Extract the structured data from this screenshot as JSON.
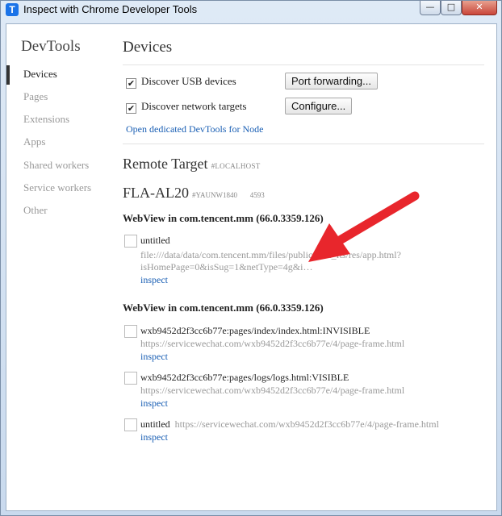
{
  "window": {
    "title": "Inspect with Chrome Developer Tools",
    "icon_letter": "T",
    "minimize": "—",
    "maximize": "□",
    "close": "✕"
  },
  "sidebar": {
    "title": "DevTools",
    "items": [
      {
        "label": "Devices",
        "active": true
      },
      {
        "label": "Pages"
      },
      {
        "label": "Extensions"
      },
      {
        "label": "Apps"
      },
      {
        "label": "Shared workers"
      },
      {
        "label": "Service workers"
      },
      {
        "label": "Other"
      }
    ]
  },
  "devices": {
    "title": "Devices",
    "discover_usb": {
      "label": "Discover USB devices",
      "checked": true
    },
    "port_forwarding_button": "Port forwarding...",
    "discover_network": {
      "label": "Discover network targets",
      "checked": true
    },
    "configure_button": "Configure...",
    "node_link": "Open dedicated DevTools for Node"
  },
  "remote_target": {
    "title": "Remote Target",
    "tag": "#LOCALHOST"
  },
  "device": {
    "name": "FLA-AL20",
    "serial": "#YAUNW1840       4593"
  },
  "webviews": [
    {
      "title": "WebView in com.tencent.mm (66.0.3359.126)",
      "targets": [
        {
          "name": "untitled",
          "url_line1": "file:///data/data/com.tencent.mm/files/public/wxa_fts/res/app.html?",
          "url_line2": "isHomePage=0&isSug=1&netType=4g&i…",
          "inspect": "inspect"
        }
      ]
    },
    {
      "title": "WebView in com.tencent.mm (66.0.3359.126)",
      "targets": [
        {
          "name": "wxb9452d2f3cc6b77e:pages/index/index.html:INVISIBLE",
          "url": "https://servicewechat.com/wxb9452d2f3cc6b77e/4/page-frame.html",
          "inspect": "inspect"
        },
        {
          "name": "wxb9452d2f3cc6b77e:pages/logs/logs.html:VISIBLE",
          "url": "https://servicewechat.com/wxb9452d2f3cc6b77e/4/page-frame.html",
          "inspect": "inspect"
        },
        {
          "name": "untitled",
          "url": "https://servicewechat.com/wxb9452d2f3cc6b77e/4/page-frame.html",
          "inspect": "inspect"
        }
      ]
    }
  ],
  "colors": {
    "link": "#1a5fb4",
    "arrow": "#e8262c"
  }
}
